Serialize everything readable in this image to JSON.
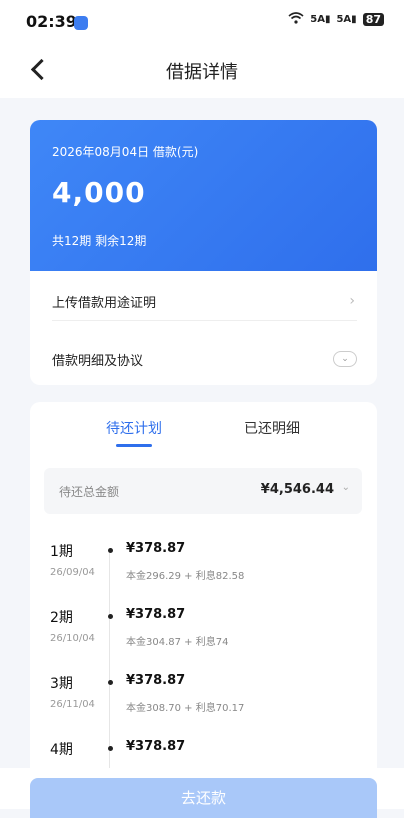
{
  "status_bar": {
    "time": "02:39",
    "signal_1": "5A",
    "signal_2": "5A",
    "battery": "87"
  },
  "nav": {
    "title": "借据详情"
  },
  "loan": {
    "date_label": "2026年08月04日 借款(元)",
    "amount": "4,000",
    "term": "共12期  剩余12期"
  },
  "rows": {
    "upload_label": "上传借款用途证明",
    "detail_label": "借款明细及协议"
  },
  "tabs": {
    "pending": "待还计划",
    "paid": "已还明细"
  },
  "total": {
    "label": "待还总金额",
    "value": "¥4,546.44"
  },
  "periods": [
    {
      "name": "1期",
      "date": "26/09/04",
      "amount": "¥378.87",
      "detail": "本金296.29 + 利息82.58"
    },
    {
      "name": "2期",
      "date": "26/10/04",
      "amount": "¥378.87",
      "detail": "本金304.87 + 利息74"
    },
    {
      "name": "3期",
      "date": "26/11/04",
      "amount": "¥378.87",
      "detail": "本金308.70 + 利息70.17"
    },
    {
      "name": "4期",
      "date": "",
      "amount": "¥378.87",
      "detail": ""
    }
  ],
  "bottom": {
    "repay_label": "去还款"
  },
  "colors": {
    "accent": "#2f6fec",
    "banner": "#3f87f7",
    "button_disabled": "#a9c8f9"
  }
}
